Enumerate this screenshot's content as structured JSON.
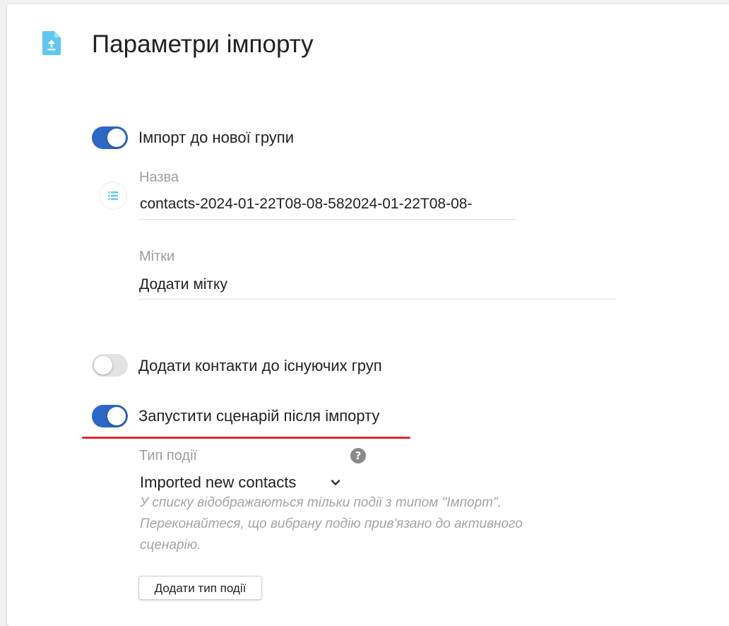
{
  "header": {
    "title": "Параметри імпорту",
    "icon": "file-upload-icon",
    "icon_color": "#5ec8f0"
  },
  "import_new_group": {
    "label": "Імпорт до нової групи",
    "enabled": true
  },
  "name_field": {
    "label": "Назва",
    "value": "contacts-2024-01-22T08-08-582024-01-22T08-08-",
    "icon": "list-icon"
  },
  "tags_field": {
    "label": "Мітки",
    "placeholder": "Додати мітку"
  },
  "add_to_existing": {
    "label": "Додати контакти до існуючих груп",
    "enabled": false
  },
  "run_scenario": {
    "label": "Запустити сценарій після імпорту",
    "enabled": true
  },
  "event_type": {
    "label": "Тип події",
    "help_icon": "help-icon",
    "selected": "Imported new contacts",
    "hint_lines": [
      "У списку відображаються тільки події з типом \"Імпорт\".",
      "Переконайтеся, що вибрану подію прив'язано до активного",
      "сценарію."
    ],
    "add_button": "Додати тип події"
  },
  "colors": {
    "toggle_on": "#2d67c6",
    "toggle_off": "#e3e3e3",
    "highlight_underline": "#e0262b",
    "accent_icon": "#5ec8f0"
  }
}
